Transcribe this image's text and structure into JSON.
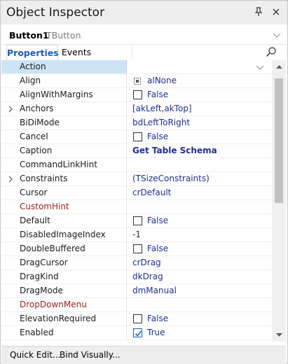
{
  "window": {
    "title": "Object Inspector"
  },
  "selector": {
    "name": "Button1",
    "class_name": "TButton"
  },
  "tabs": [
    {
      "label": "Properties",
      "active": true
    },
    {
      "label": "Events",
      "active": false
    }
  ],
  "properties": [
    {
      "name": "Action",
      "value": "",
      "type": "dropdown",
      "selected": true
    },
    {
      "name": "Align",
      "value": "alNone",
      "type": "align"
    },
    {
      "name": "AlignWithMargins",
      "value": "False",
      "type": "checkbox",
      "checked": false
    },
    {
      "name": "Anchors",
      "value": "[akLeft,akTop]",
      "type": "expand"
    },
    {
      "name": "BiDiMode",
      "value": "bdLeftToRight",
      "type": "text"
    },
    {
      "name": "Cancel",
      "value": "False",
      "type": "checkbox",
      "checked": false
    },
    {
      "name": "Caption",
      "value": "Get Table Schema",
      "type": "bold"
    },
    {
      "name": "CommandLinkHint",
      "value": "",
      "type": "text"
    },
    {
      "name": "Constraints",
      "value": "(TSizeConstraints)",
      "type": "expand"
    },
    {
      "name": "Cursor",
      "value": "crDefault",
      "type": "text"
    },
    {
      "name": "CustomHint",
      "value": "",
      "type": "event"
    },
    {
      "name": "Default",
      "value": "False",
      "type": "checkbox",
      "checked": false
    },
    {
      "name": "DisabledImageIndex",
      "value": "-1",
      "type": "text"
    },
    {
      "name": "DoubleBuffered",
      "value": "False",
      "type": "checkbox",
      "checked": false
    },
    {
      "name": "DragCursor",
      "value": "crDrag",
      "type": "text"
    },
    {
      "name": "DragKind",
      "value": "dkDrag",
      "type": "text"
    },
    {
      "name": "DragMode",
      "value": "dmManual",
      "type": "text"
    },
    {
      "name": "DropDownMenu",
      "value": "",
      "type": "event"
    },
    {
      "name": "ElevationRequired",
      "value": "False",
      "type": "checkbox",
      "checked": false
    },
    {
      "name": "Enabled",
      "value": "True",
      "type": "checkbox",
      "checked": true
    }
  ],
  "bottombar": {
    "quick_edit": "Quick Edit...",
    "bind_visually": "Bind Visually..."
  },
  "colors": {
    "accent": "#1a5fb4",
    "value_text": "#1f2f8c",
    "event_text": "#9a2020",
    "selected_row": "#cde4f7"
  }
}
